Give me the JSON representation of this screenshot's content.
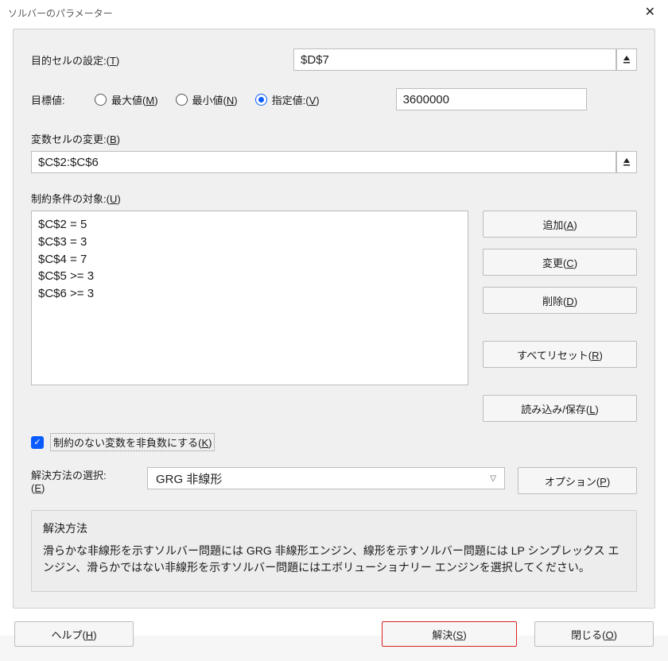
{
  "title": "ソルバーのパラメーター",
  "labels": {
    "objective": "目的セルの設定:",
    "objective_shortcut": "T",
    "target": "目標値:",
    "radio_max": "最大値(",
    "radio_max_s": "M",
    "radio_max_close": ")",
    "radio_min": "最小値(",
    "radio_min_s": "N",
    "radio_min_close": ")",
    "radio_val": "指定値:(",
    "radio_val_s": "V",
    "radio_val_close": ")",
    "variables": "変数セルの変更:",
    "variables_s": "B",
    "constraints": "制約条件の対象:",
    "constraints_s": "U",
    "nonneg": "制約のない変数を非負数にする(",
    "nonneg_s": "K",
    "nonneg_close": ")",
    "method": "解決方法の選択:",
    "method_s": "E",
    "desc_title": "解決方法",
    "desc_body": "滑らかな非線形を示すソルバー問題には GRG 非線形エンジン、線形を示すソルバー問題には LP シンプレックス エンジン、滑らかではない非線形を示すソルバー問題にはエボリューショナリー エンジンを選択してください。"
  },
  "fields": {
    "objective_cell": "$D$7",
    "target_value": "3600000",
    "variable_cells": "$C$2:$C$6",
    "method_selected": "GRG 非線形"
  },
  "constraints_list": [
    "$C$2 = 5",
    "$C$3 = 3",
    "$C$4 = 7",
    "$C$5 >= 3",
    "$C$6 >= 3"
  ],
  "buttons": {
    "add": "追加(",
    "add_s": "A",
    "change": "変更(",
    "change_s": "C",
    "delete": "削除(",
    "delete_s": "D",
    "reset": "すべてリセット(",
    "reset_s": "R",
    "loadsave": "読み込み/保存(",
    "loadsave_s": "L",
    "options": "オプション(",
    "options_s": "P",
    "help": "ヘルプ(",
    "help_s": "H",
    "solve": "解決(",
    "solve_s": "S",
    "close": "閉じる(",
    "close_s": "O",
    "paren_close": ")"
  }
}
